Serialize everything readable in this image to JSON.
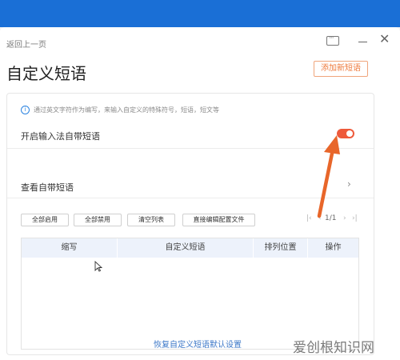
{
  "window": {
    "back_label": "返回上一页",
    "title": "自定义短语",
    "add_button": "添加新短语"
  },
  "card": {
    "tip": "通过英文字符作为编写，来输入自定义的特殊符号，短语，短文等",
    "toggle_label": "开启输入法自带短语",
    "toggle_on": true,
    "view_label": "查看自带短语"
  },
  "toolbar": {
    "enable_all": "全部启用",
    "disable_all": "全部禁用",
    "clear_list": "清空列表",
    "edit_config": "直接编辑配置文件"
  },
  "pager": {
    "first": "|‹",
    "prev": "‹",
    "page": "1/1",
    "next": "›",
    "last": "›|"
  },
  "table": {
    "columns": [
      "缩写",
      "自定义短语",
      "排列位置",
      "操作"
    ],
    "rows": []
  },
  "footer": {
    "restore": "恢复自定义短语默认设置"
  },
  "watermark": "爱创根知识网",
  "colors": {
    "title_bar": "#1a6fd6",
    "accent_orange": "#ee7a3c",
    "toggle_on": "#ee5a3b",
    "link_blue": "#3d78c8",
    "table_header": "#edf2fb"
  }
}
